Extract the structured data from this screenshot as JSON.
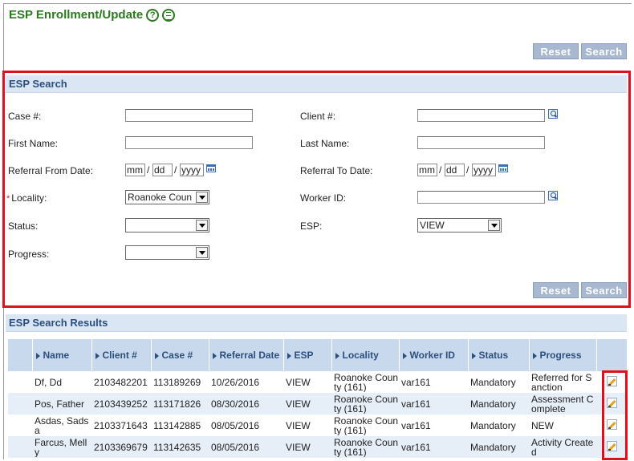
{
  "page": {
    "title": "ESP Enrollment/Update",
    "help_icon": "question-circle-icon",
    "doc_icon": "document-icon"
  },
  "toolbar": {
    "reset_label": "Reset",
    "search_label": "Search"
  },
  "search": {
    "header": "ESP Search",
    "case_label": "Case #:",
    "client_label": "Client #:",
    "first_name_label": "First Name:",
    "last_name_label": "Last Name:",
    "referral_from_label": "Referral From Date:",
    "referral_to_label": "Referral To Date:",
    "locality_label": "Locality:",
    "locality_required": "*",
    "locality_value": "Roanoke Coun",
    "worker_id_label": "Worker ID:",
    "status_label": "Status:",
    "status_value": "",
    "esp_label": "ESP:",
    "esp_value": "VIEW",
    "progress_label": "Progress:",
    "progress_value": "",
    "date_mm": "mm",
    "date_dd": "dd",
    "date_yyyy": "yyyy",
    "date_sep": "/",
    "reset_label": "Reset",
    "search_label": "Search"
  },
  "results": {
    "header": "ESP Search Results",
    "columns": [
      "Name",
      "Client #",
      "Case #",
      "Referral Date",
      "ESP",
      "Locality",
      "Worker ID",
      "Status",
      "Progress",
      ""
    ],
    "rows": [
      {
        "name": "Df, Dd",
        "client": "2103482201",
        "case": "113189269",
        "referral_date": "10/26/2016",
        "esp": "VIEW",
        "locality": "Roanoke County (161)",
        "worker_id": "var161",
        "status": "Mandatory",
        "progress": "Referred for Sanction"
      },
      {
        "name": "Pos, Father",
        "client": "2103439252",
        "case": "113171826",
        "referral_date": "08/30/2016",
        "esp": "VIEW",
        "locality": "Roanoke County (161)",
        "worker_id": "var161",
        "status": "Mandatory",
        "progress": "Assessment Complete"
      },
      {
        "name": "Asdas, Sadsa",
        "client": "2103371643",
        "case": "113142885",
        "referral_date": "08/05/2016",
        "esp": "VIEW",
        "locality": "Roanoke County (161)",
        "worker_id": "var161",
        "status": "Mandatory",
        "progress": "NEW"
      },
      {
        "name": "Farcus, Melly",
        "client": "2103369679",
        "case": "113142635",
        "referral_date": "08/05/2016",
        "esp": "VIEW",
        "locality": "Roanoke County (161)",
        "worker_id": "var161",
        "status": "Mandatory",
        "progress": "Activity Created"
      }
    ]
  },
  "colors": {
    "title_green": "#2a7a1e",
    "section_blue": "#2b4f7e",
    "highlight_red": "#e0101a",
    "button_bg": "#a8b8d0"
  }
}
